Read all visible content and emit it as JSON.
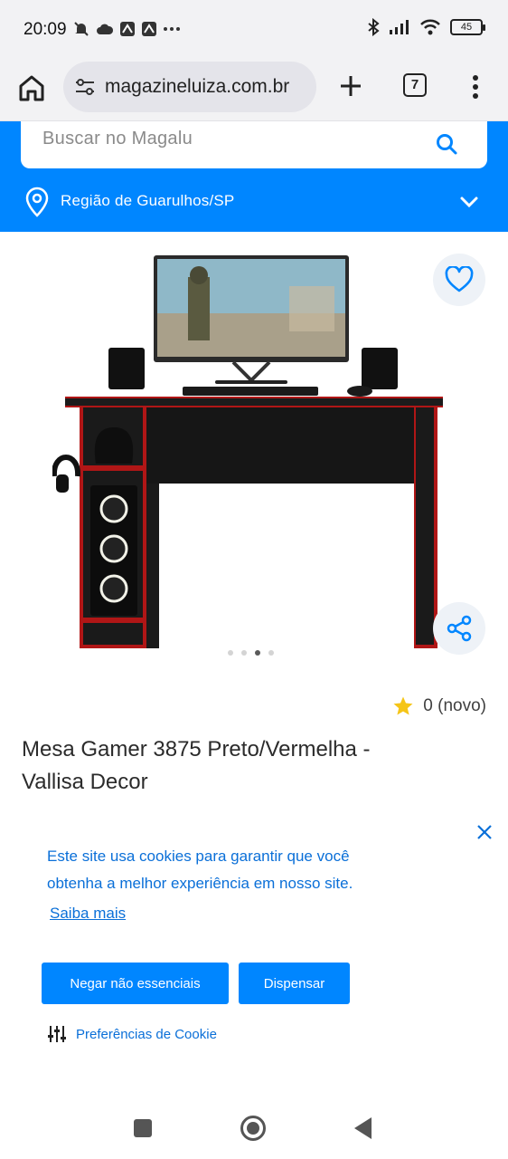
{
  "status_bar": {
    "time": "20:09",
    "battery": "45"
  },
  "browser": {
    "url": "magazineluiza.com.br",
    "tab_count": "7"
  },
  "header": {
    "search_placeholder": "Buscar no Magalu",
    "region": "Região de Guarulhos/SP",
    "brand_color": "#0086ff"
  },
  "product": {
    "carousel_total": 4,
    "carousel_active": 3,
    "rating_text": "0 (novo)",
    "title_line1": "Mesa Gamer 3875 Preto/Vermelha -",
    "title_line2": "Vallisa Decor"
  },
  "cookie_banner": {
    "text_line1": "Este site usa cookies para garantir que você",
    "text_line2": "obtenha a melhor experiência em nosso site.",
    "learn_more": "Saiba mais",
    "deny_label": "Negar não essenciais",
    "dismiss_label": "Dispensar",
    "preferences_label": "Preferências de Cookie"
  }
}
